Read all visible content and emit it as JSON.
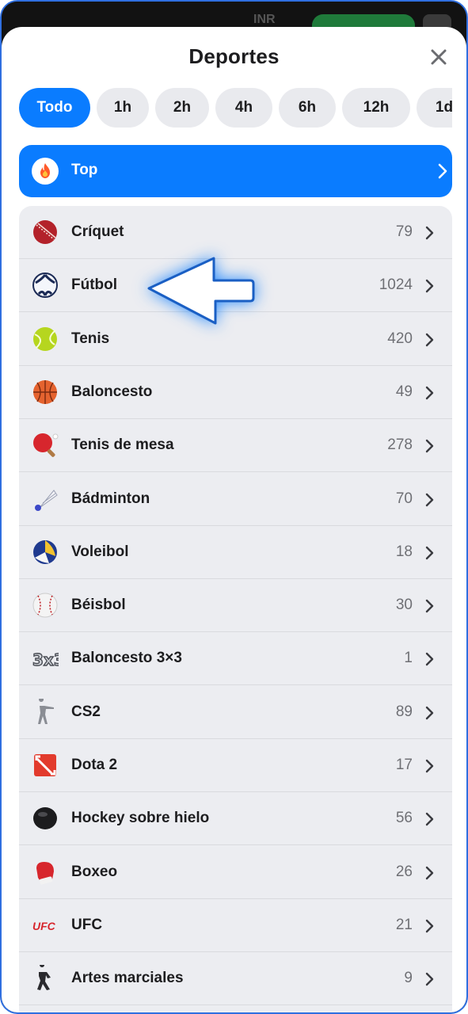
{
  "topbar": {
    "currency": "INR"
  },
  "sheet": {
    "title": "Deportes"
  },
  "filters": [
    "Todo",
    "1h",
    "2h",
    "4h",
    "6h",
    "12h",
    "1d"
  ],
  "top": {
    "label": "Top"
  },
  "sports": [
    {
      "name": "Críquet",
      "count": "79",
      "icon": "cricket-ball-icon"
    },
    {
      "name": "Fútbol",
      "count": "1024",
      "icon": "soccer-ball-icon"
    },
    {
      "name": "Tenis",
      "count": "420",
      "icon": "tennis-ball-icon"
    },
    {
      "name": "Baloncesto",
      "count": "49",
      "icon": "basketball-icon"
    },
    {
      "name": "Tenis de mesa",
      "count": "278",
      "icon": "ping-pong-paddle-icon"
    },
    {
      "name": "Bádminton",
      "count": "70",
      "icon": "shuttlecock-icon"
    },
    {
      "name": "Voleibol",
      "count": "18",
      "icon": "volleyball-icon"
    },
    {
      "name": "Béisbol",
      "count": "30",
      "icon": "baseball-icon"
    },
    {
      "name": "Baloncesto 3×3",
      "count": "1",
      "icon": "basketball-3x3-icon"
    },
    {
      "name": "CS2",
      "count": "89",
      "icon": "soldier-icon"
    },
    {
      "name": "Dota 2",
      "count": "17",
      "icon": "dota-logo-icon"
    },
    {
      "name": "Hockey sobre hielo",
      "count": "56",
      "icon": "hockey-puck-icon"
    },
    {
      "name": "Boxeo",
      "count": "26",
      "icon": "boxing-glove-icon"
    },
    {
      "name": "UFC",
      "count": "21",
      "icon": "ufc-logo-icon"
    },
    {
      "name": "Artes marciales",
      "count": "9",
      "icon": "martial-arts-icon"
    }
  ],
  "colors": {
    "accent": "#0a7cff",
    "list_bg": "#ecedf1",
    "chip_bg": "#e9eaee"
  }
}
